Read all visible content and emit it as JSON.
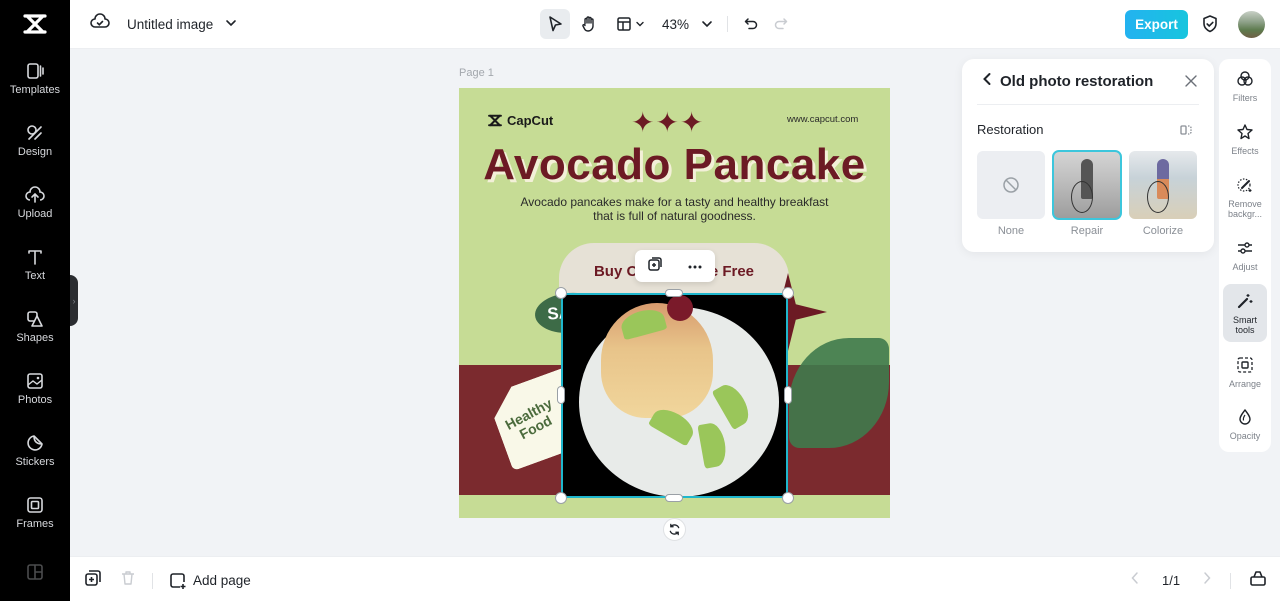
{
  "app": {
    "title": "Untitled image",
    "zoom_level": "43%",
    "export_label": "Export"
  },
  "sidebar": {
    "items": [
      {
        "label": "Templates",
        "icon": "templates-icon"
      },
      {
        "label": "Design",
        "icon": "design-icon"
      },
      {
        "label": "Upload",
        "icon": "upload-icon"
      },
      {
        "label": "Text",
        "icon": "text-icon"
      },
      {
        "label": "Shapes",
        "icon": "shapes-icon"
      },
      {
        "label": "Photos",
        "icon": "photos-icon"
      },
      {
        "label": "Stickers",
        "icon": "stickers-icon"
      },
      {
        "label": "Frames",
        "icon": "frames-icon"
      }
    ]
  },
  "canvas": {
    "page_label": "Page 1",
    "poster": {
      "brand": "CapCut",
      "url": "www.capcut.com",
      "stars": "✦✦✦",
      "title": "Avocado Pancake",
      "subtitle": "Avocado pancakes make for a tasty and healthy breakfast that is full of natural goodness.",
      "buy_text": "Buy One Get One Free",
      "sale_text": "SALE",
      "tag_text_line1": "Healthy",
      "tag_text_line2": "Food"
    }
  },
  "panel": {
    "title": "Old photo restoration",
    "section_title": "Restoration",
    "options": [
      {
        "label": "None",
        "selected": false
      },
      {
        "label": "Repair",
        "selected": true
      },
      {
        "label": "Colorize",
        "selected": false
      }
    ]
  },
  "rail": {
    "items": [
      {
        "label": "Filters"
      },
      {
        "label": "Effects"
      },
      {
        "label": "Remove backgr..."
      },
      {
        "label": "Adjust"
      },
      {
        "label": "Smart tools",
        "active": true
      },
      {
        "label": "Arrange"
      },
      {
        "label": "Opacity"
      }
    ]
  },
  "bottom": {
    "add_page_label": "Add page",
    "page_count": "1/1"
  },
  "colors": {
    "accent": "#1fb6cc",
    "export_gradient_start": "#23b2f0",
    "export_gradient_end": "#17c5de",
    "poster_bg": "#c6dc95",
    "poster_maroon": "#6c1a24"
  }
}
